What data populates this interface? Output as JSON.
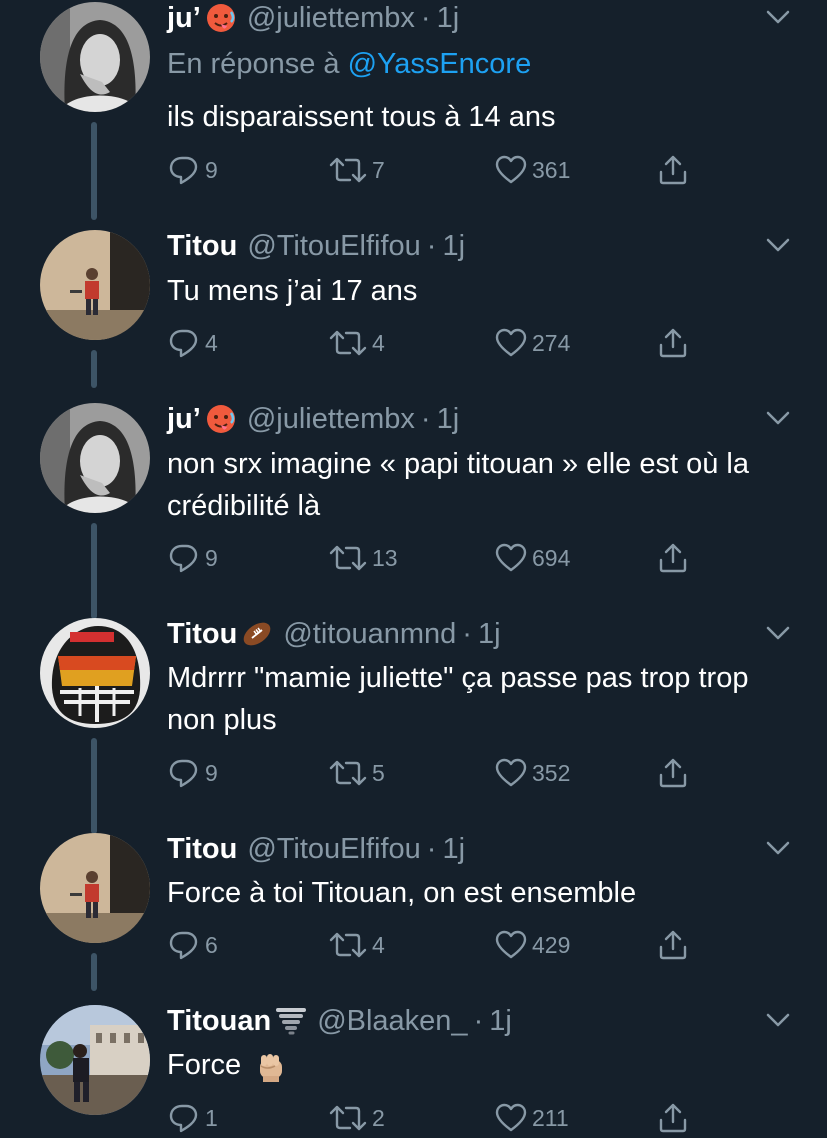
{
  "tweets": [
    {
      "name": "ju’",
      "badge": "hot-face-emoji",
      "handle": "@juliettembx",
      "sep": "·",
      "time": "1j",
      "reply_prefix": "En réponse à",
      "reply_mention": "@YassEncore",
      "text": "ils disparaissent tous à 14 ans",
      "replies": "9",
      "retweets": "7",
      "likes": "361",
      "avatar": "girl-bw-photo"
    },
    {
      "name": "Titou",
      "handle": "@TitouElfifou",
      "sep": "·",
      "time": "1j",
      "text": "Tu mens j’ai 17 ans",
      "replies": "4",
      "retweets": "4",
      "likes": "274",
      "avatar": "boy-red-shirt-photo"
    },
    {
      "name": "ju’",
      "badge": "hot-face-emoji",
      "handle": "@juliettembx",
      "sep": "·",
      "time": "1j",
      "text": "non srx imagine « papi titouan » elle est où la crédibilité là",
      "replies": "9",
      "retweets": "13",
      "likes": "694",
      "avatar": "girl-bw-photo"
    },
    {
      "name": "Titou",
      "badge": "american-football-emoji",
      "handle": "@titouanmnd",
      "sep": "·",
      "time": "1j",
      "text": "Mdrrrr \"mamie juliette\" ça passe pas trop trop non plus",
      "replies": "9",
      "retweets": "5",
      "likes": "352",
      "avatar": "football-helmet-photo"
    },
    {
      "name": "Titou",
      "handle": "@TitouElfifou",
      "sep": "·",
      "time": "1j",
      "text": "Force à toi Titouan, on est ensemble",
      "replies": "6",
      "retweets": "4",
      "likes": "429",
      "avatar": "boy-red-shirt-photo"
    },
    {
      "name": "Titouan",
      "badge": "tornado-emoji",
      "handle": "@Blaaken_",
      "sep": "·",
      "time": "1j",
      "text": "Force",
      "text_emoji": "raised-fist-emoji",
      "replies": "1",
      "retweets": "2",
      "likes": "211",
      "avatar": "man-outdoor-photo"
    }
  ],
  "colors": {
    "background": "#15202b",
    "secondary_text": "#8899a6",
    "mention": "#1da1f2",
    "thread_line": "#3d5466"
  }
}
